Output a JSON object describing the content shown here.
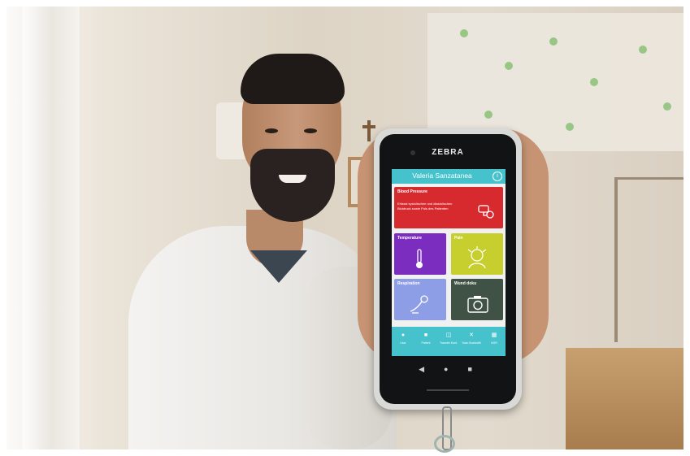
{
  "phone": {
    "brand": "ZEBRA",
    "app_title": "Valeria Sanzatanea",
    "info_icon": "info-icon",
    "tiles": [
      {
        "title": "Blood Pressure",
        "description": "Erfasst systolischen und diastolischen Blutdruck sowie Puls des Patienten",
        "icon": "blood-pressure-icon",
        "color": "#d62a2f"
      },
      {
        "title": "Temperature",
        "icon": "thermometer-icon",
        "color": "#7b2dbf"
      },
      {
        "title": "Pain",
        "icon": "pain-face-icon",
        "color": "#c7cf2e"
      },
      {
        "title": "Respiration",
        "icon": "respiration-icon",
        "color": "#8d9ee6"
      },
      {
        "title": "Wund doku",
        "icon": "camera-icon",
        "color": "#3f5245"
      }
    ],
    "nav": [
      {
        "label": "User",
        "icon": "user-icon"
      },
      {
        "label": "Patient",
        "icon": "patient-icon"
      },
      {
        "label": "Transfer Kont.",
        "icon": "transfer-icon"
      },
      {
        "label": "Scan Boxfastfit",
        "icon": "scan-icon"
      },
      {
        "label": "NGR",
        "icon": "qr-icon"
      }
    ],
    "accent_color": "#45c2cc"
  }
}
